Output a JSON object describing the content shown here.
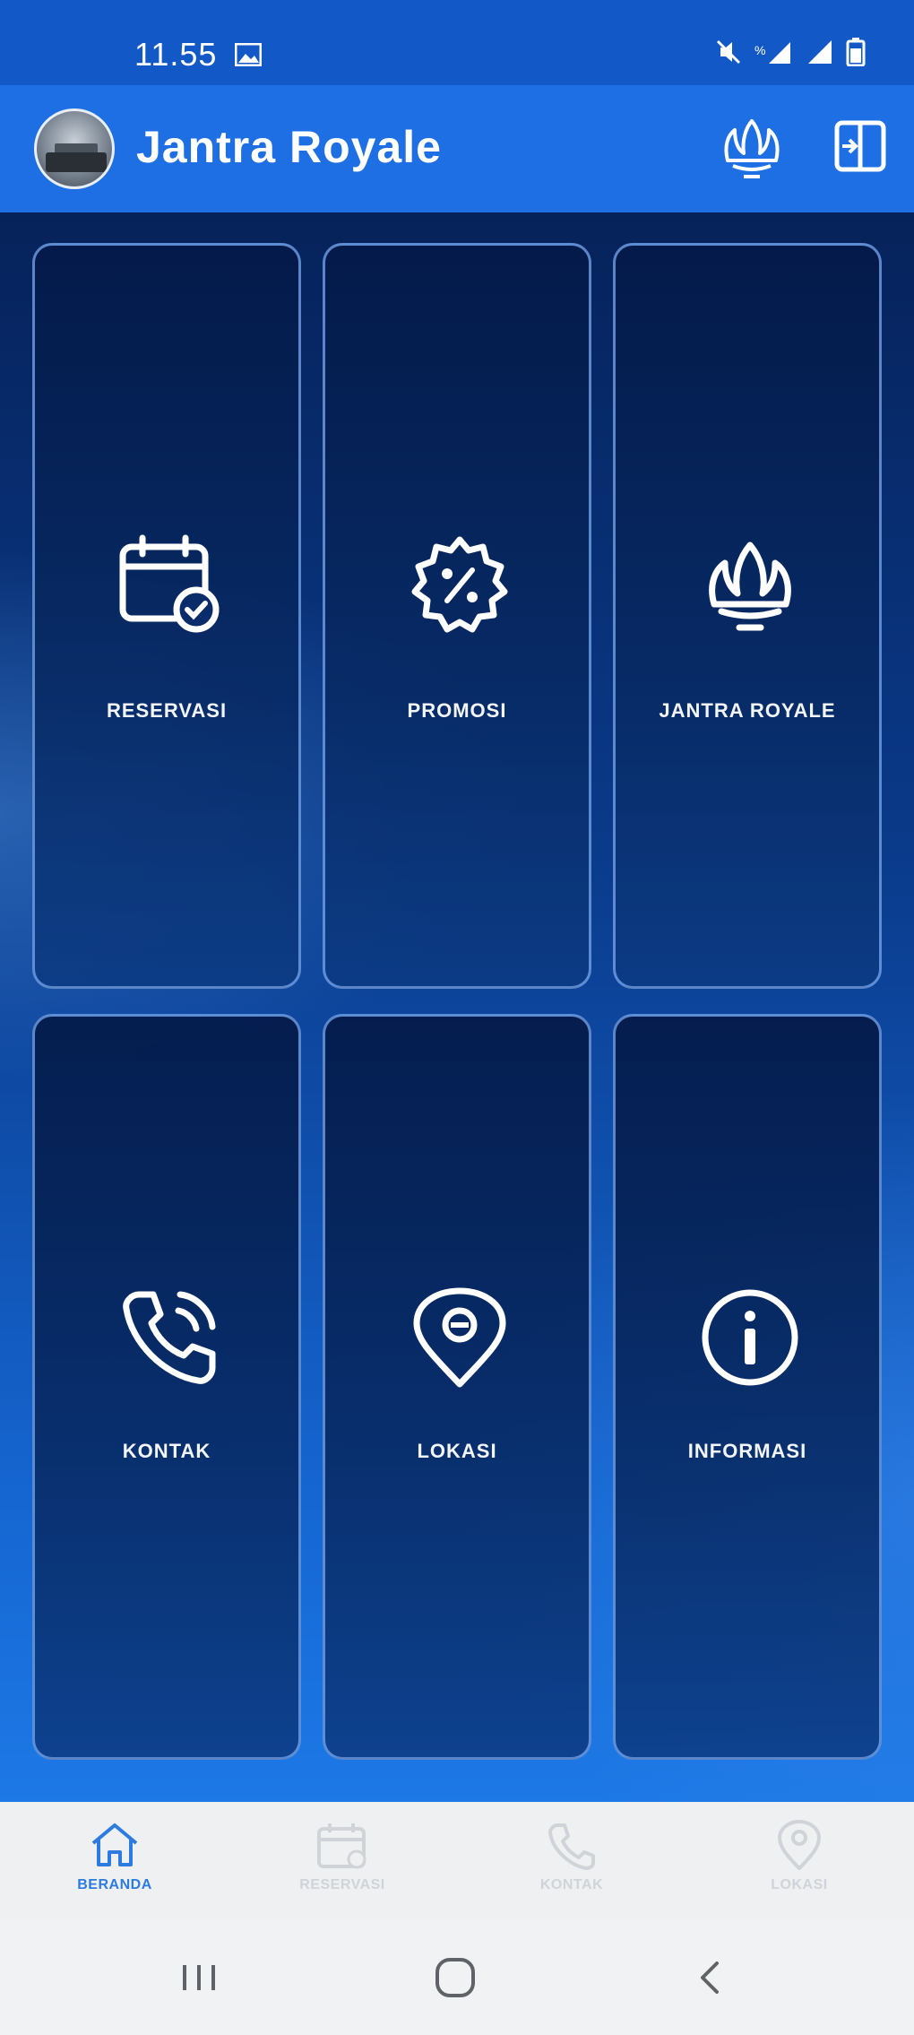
{
  "status_bar": {
    "time": "11.55",
    "icons": [
      "image-icon",
      "mute-icon",
      "volte-signal-icon",
      "signal-icon",
      "battery-icon"
    ]
  },
  "app_bar": {
    "title": "Jantra Royale",
    "actions": [
      "crown-icon",
      "exit-icon"
    ]
  },
  "tiles": [
    {
      "label": "RESERVASI",
      "icon": "calendar-check-icon"
    },
    {
      "label": "PROMOSI",
      "icon": "discount-badge-icon"
    },
    {
      "label": "JANTRA ROYALE",
      "icon": "crown-icon"
    },
    {
      "label": "KONTAK",
      "icon": "phone-icon"
    },
    {
      "label": "LOKASI",
      "icon": "location-pin-icon"
    },
    {
      "label": "INFORMASI",
      "icon": "info-icon"
    }
  ],
  "bottom_nav": {
    "items": [
      {
        "label": "BERANDA",
        "icon": "home-icon",
        "active": true
      },
      {
        "label": "RESERVASI",
        "icon": "calendar-icon",
        "active": false
      },
      {
        "label": "KONTAK",
        "icon": "phone-icon",
        "active": false
      },
      {
        "label": "LOKASI",
        "icon": "location-icon",
        "active": false
      }
    ]
  },
  "system_nav": [
    "recents-icon",
    "home-circle-icon",
    "back-icon"
  ],
  "colors": {
    "status_bar": "#1259c7",
    "app_bar": "#1d6fe3",
    "tile_border": "#78aaf0",
    "nav_active": "#2d7be0",
    "nav_inactive": "#d0d4d9"
  }
}
